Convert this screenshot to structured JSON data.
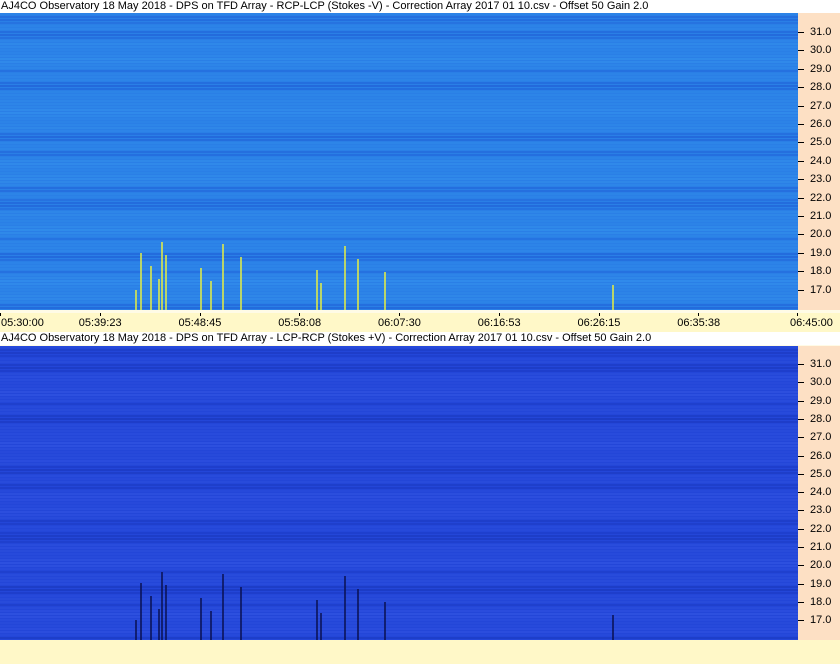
{
  "panels": [
    {
      "title": "AJ4CO Observatory 18 May 2018  -  DPS on TFD Array  -  RCP-LCP (Stokes -V)  -  Correction Array 2017 01 10.csv  -  Offset 50  Gain 2.0",
      "colors": {
        "base": "#2a7fe6",
        "dark": "#1a4fcf",
        "burst": "#e8f040"
      }
    },
    {
      "title": "AJ4CO Observatory 18 May 2018  -  DPS on TFD Array  -  LCP-RCP (Stokes +V)  -  Correction Array 2017 01 10.csv  -  Offset 50  Gain 2.0",
      "colors": {
        "base": "#2346d8",
        "dark": "#1530b0",
        "burst": "#0a1050"
      }
    }
  ],
  "freq_axis": {
    "labels": [
      "31.0",
      "30.0",
      "29.0",
      "28.0",
      "27.0",
      "26.0",
      "25.0",
      "24.0",
      "23.0",
      "22.0",
      "21.0",
      "20.0",
      "19.0",
      "18.0",
      "17.0"
    ]
  },
  "time_axis": {
    "labels": [
      "05:30:00",
      "05:39:23",
      "05:48:45",
      "05:58:08",
      "06:07:30",
      "06:16:53",
      "06:26:15",
      "06:35:38",
      "06:45:00"
    ]
  }
}
